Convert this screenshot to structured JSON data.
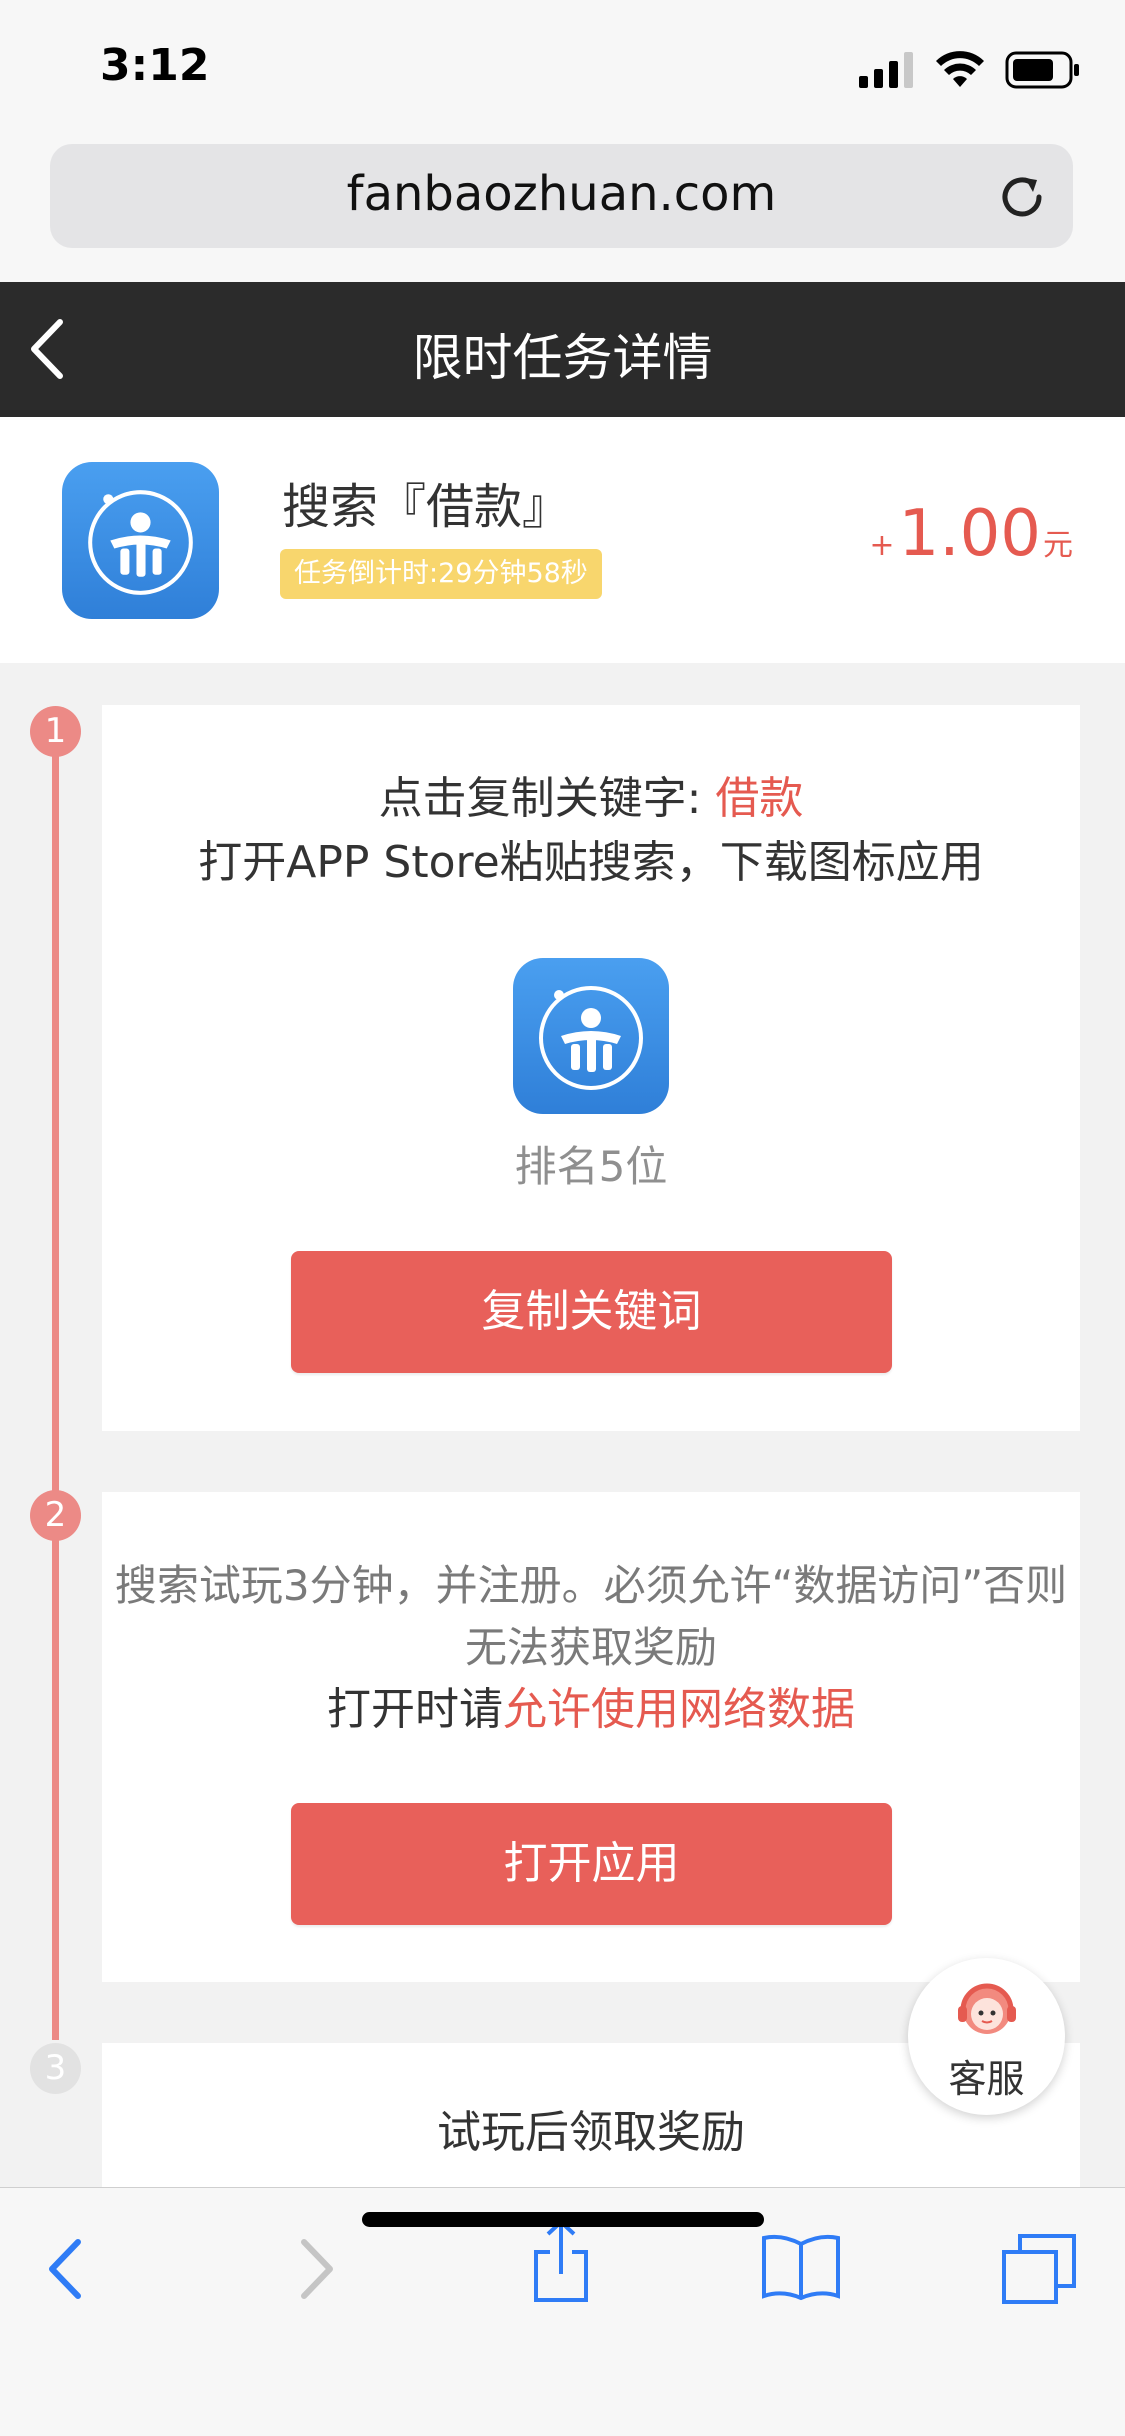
{
  "status_bar": {
    "time": "3:12"
  },
  "browser": {
    "url": "fanbaozhuan.com"
  },
  "header": {
    "title": "限时任务详情"
  },
  "task": {
    "name": "搜索『借款』",
    "countdown": "任务倒计时:29分钟58秒",
    "reward_plus": "+",
    "reward_amount": "1.00",
    "reward_unit": "元"
  },
  "steps": [
    {
      "number": "1",
      "line1_prefix": "点击复制关键字: ",
      "keyword": "借款",
      "line2": "打开APP Store粘贴搜索，下载图标应用",
      "rank": "排名5位",
      "button_label": "复制关键词"
    },
    {
      "number": "2",
      "note_line1": "搜索试玩3分钟，并注册。必须允许“数据访问”否则",
      "note_line2": "无法获取奖励",
      "open_prefix": "打开时请",
      "open_highlight": "允许使用网络数据",
      "button_label": "打开应用"
    },
    {
      "number": "3",
      "text": "试玩后领取奖励"
    }
  ],
  "customer_service": {
    "label": "客服"
  },
  "colors": {
    "accent_red": "#e8605a",
    "timeline": "#ec8a86",
    "badge_yellow": "#f8d66d",
    "header_bg": "#2b2b2b",
    "safari_blue": "#2f7cf6",
    "app_icon_blue": "#3b8de0"
  },
  "icons": {
    "back": "chevron-left-icon",
    "reload": "reload-icon",
    "app": "app-logo-icon",
    "toolbar": [
      "back-arrow-icon",
      "forward-arrow-icon",
      "share-icon",
      "bookmarks-icon",
      "tabs-icon"
    ]
  }
}
